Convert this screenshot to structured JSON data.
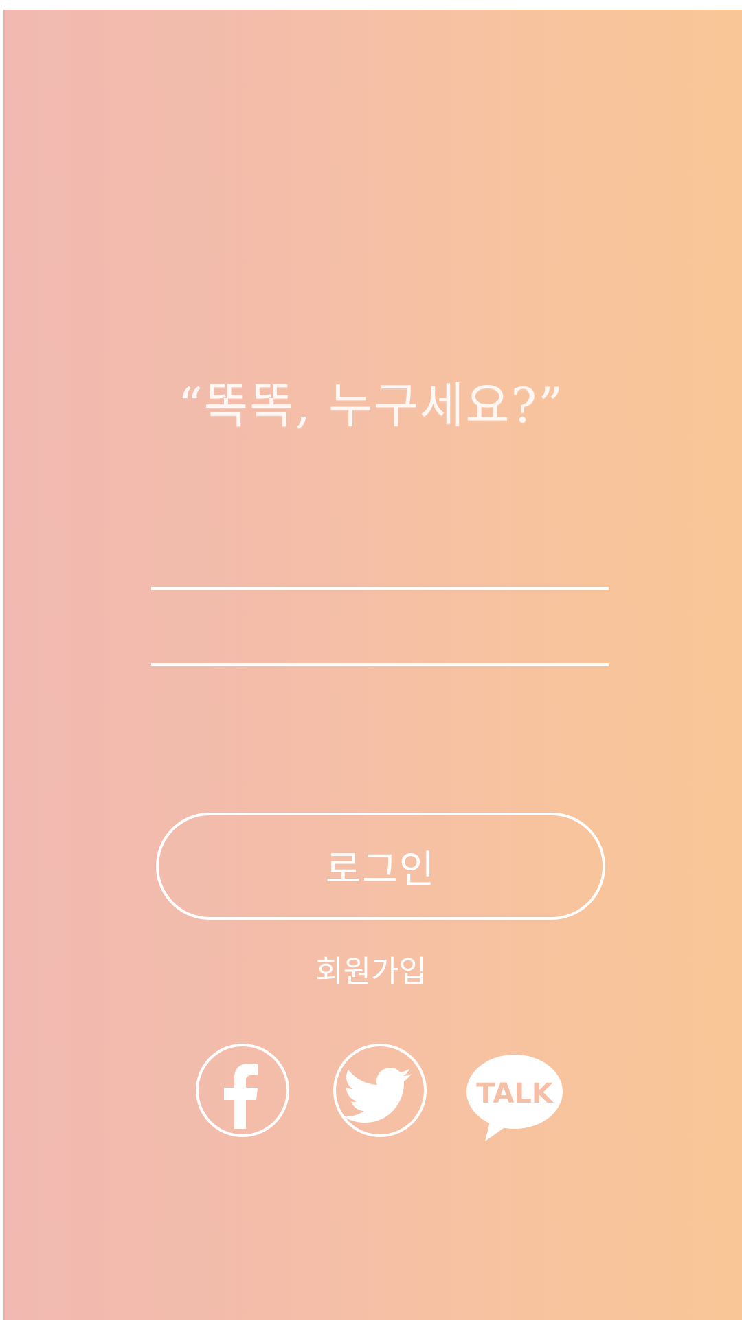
{
  "app": {
    "title": "“똑똑, 누구세요?”"
  },
  "form": {
    "id_field": {
      "value": "",
      "placeholder": ""
    },
    "password_field": {
      "value": "",
      "placeholder": ""
    },
    "login_label": "로그인",
    "signup_label": "회원가입"
  },
  "social": {
    "facebook_icon": "facebook-icon",
    "twitter_icon": "twitter-icon",
    "kakao_icon": "kakaotalk-icon",
    "kakao_text": "TALK"
  },
  "colors": {
    "gradient_start": "#f1b9b1",
    "gradient_end": "#f9c697",
    "foreground": "#ffffff"
  }
}
